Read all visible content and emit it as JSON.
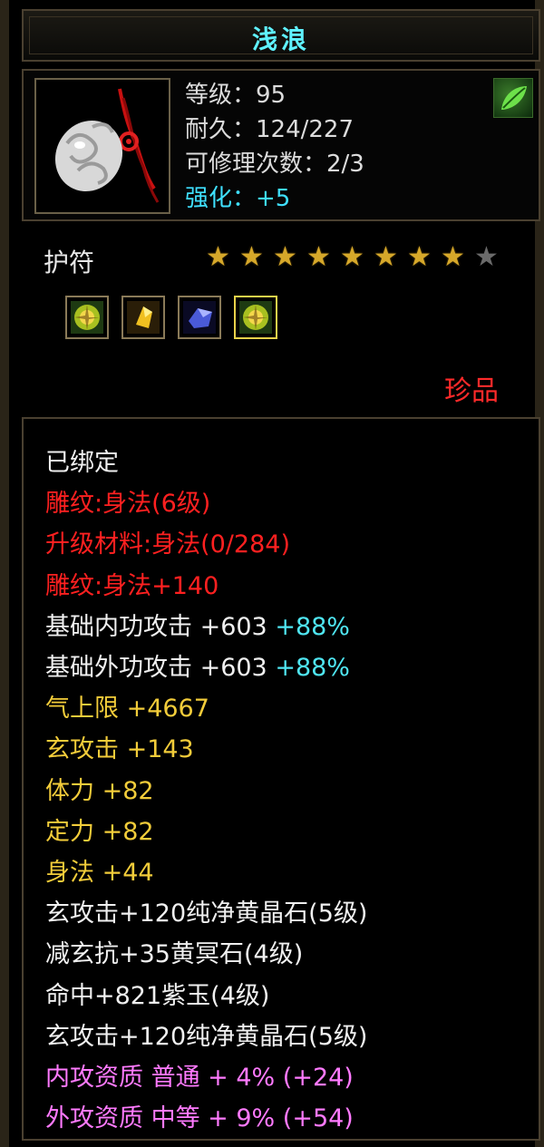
{
  "title": "浅浪",
  "item": {
    "icon": "jade-amulet-icon",
    "level_line": "等级：95",
    "durability_line": "耐久：124/227",
    "repair_line": "可修理次数：2/3",
    "enhance_line": "强化：+5",
    "type_icon": "green-leaf-icon"
  },
  "category": "护符",
  "stars": {
    "filled": 8,
    "total": 9
  },
  "gems": [
    "yellow-gem-icon",
    "gold-crystal-icon",
    "blue-sapphire-icon",
    "yellow-gem-icon"
  ],
  "rarity": "珍品",
  "details": [
    {
      "parts": [
        {
          "text": "已绑定",
          "color": "white"
        }
      ]
    },
    {
      "parts": [
        {
          "text": "雕纹:身法(6级)",
          "color": "red"
        }
      ]
    },
    {
      "parts": [
        {
          "text": "升级材料:身法(0/284)",
          "color": "red"
        }
      ]
    },
    {
      "parts": [
        {
          "text": "雕纹:身法+140",
          "color": "red"
        }
      ]
    },
    {
      "parts": [
        {
          "text": "基础内功攻击 +603 ",
          "color": "white"
        },
        {
          "text": "+88%",
          "color": "cyan"
        }
      ]
    },
    {
      "parts": [
        {
          "text": "基础外功攻击 +603 ",
          "color": "white"
        },
        {
          "text": "+88%",
          "color": "cyan"
        }
      ]
    },
    {
      "parts": [
        {
          "text": "气上限 +4667",
          "color": "yellow"
        }
      ]
    },
    {
      "parts": [
        {
          "text": "玄攻击 +143",
          "color": "yellow"
        }
      ]
    },
    {
      "parts": [
        {
          "text": "体力 +82",
          "color": "yellow"
        }
      ]
    },
    {
      "parts": [
        {
          "text": "定力 +82",
          "color": "yellow"
        }
      ]
    },
    {
      "parts": [
        {
          "text": "身法 +44",
          "color": "yellow"
        }
      ]
    },
    {
      "parts": [
        {
          "text": "玄攻击+120纯净黄晶石(5级)",
          "color": "white"
        }
      ]
    },
    {
      "parts": [
        {
          "text": "减玄抗+35黄冥石(4级)",
          "color": "white"
        }
      ]
    },
    {
      "parts": [
        {
          "text": "命中+821紫玉(4级)",
          "color": "white"
        }
      ]
    },
    {
      "parts": [
        {
          "text": "玄攻击+120纯净黄晶石(5级)",
          "color": "white"
        }
      ]
    },
    {
      "parts": [
        {
          "text": "内攻资质 普通 + 4% (+24)",
          "color": "pink"
        }
      ]
    },
    {
      "parts": [
        {
          "text": "外攻资质 中等 + 9% (+54)",
          "color": "pink"
        }
      ]
    }
  ]
}
